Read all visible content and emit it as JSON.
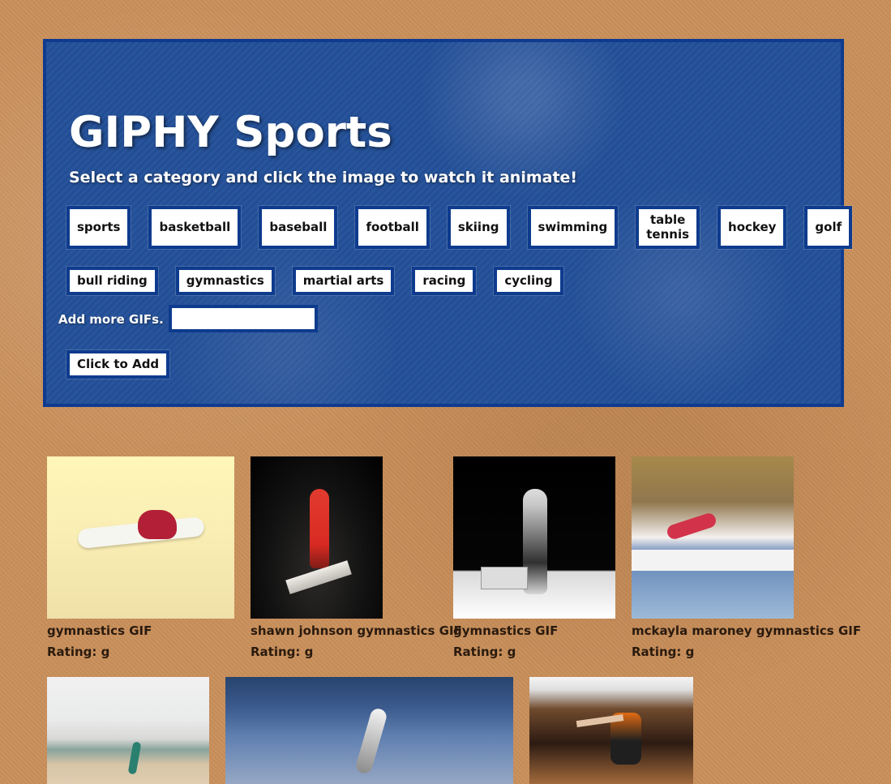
{
  "header": {
    "title": "GIPHY Sports",
    "subtitle": "Select a category and click the image to watch it animate!"
  },
  "categories": [
    "sports",
    "basketball",
    "baseball",
    "football",
    "skiing",
    "swimming",
    "table tennis",
    "hockey",
    "golf",
    "bull riding",
    "gymnastics",
    "martial arts",
    "racing",
    "cycling"
  ],
  "add_section": {
    "label": "Add more GIFs.",
    "input_value": "",
    "button_label": "Click to Add"
  },
  "gifs": [
    {
      "caption": "gymnastics GIF",
      "rating": "Rating: g",
      "icon": "gymnastics-image"
    },
    {
      "caption": "shawn johnson gymnastics GIF",
      "rating": "Rating: g",
      "icon": "gymnastics-image"
    },
    {
      "caption": "gymnastics GIF",
      "rating": "Rating: g",
      "icon": "gymnastics-image"
    },
    {
      "caption": "mckayla maroney gymnastics GIF",
      "rating": "Rating: g",
      "icon": "gymnastics-image"
    },
    {
      "icon": "gymnastics-image"
    },
    {
      "icon": "gymnastics-image"
    },
    {
      "icon": "gymnastics-image"
    }
  ],
  "colors": {
    "background": "#c98f5a",
    "panel": "#24519a",
    "panel_border": "#0f3b8f",
    "button_border": "#0e3b8d",
    "button_text": "#111111",
    "caption_text": "#2a1a0e",
    "white": "#ffffff"
  }
}
